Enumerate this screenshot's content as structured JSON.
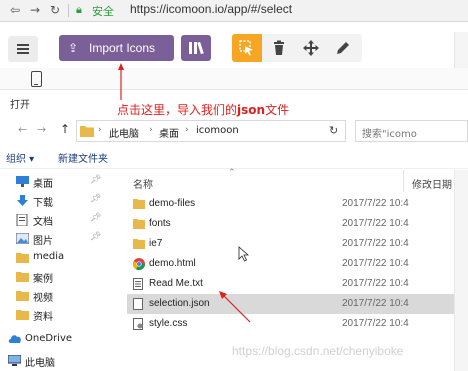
{
  "browser": {
    "secure_label": "安全",
    "url": "https://icomoon.io/app/#/select"
  },
  "toolbar": {
    "import_label": "Import Icons"
  },
  "dialog": {
    "title": "打开",
    "annotation_prefix": "点击这里，导入我们的",
    "annotation_bold": "json",
    "annotation_suffix": "文件",
    "breadcrumb": [
      "此电脑",
      "桌面",
      "icomoon"
    ],
    "search_placeholder": "搜索\"icomo",
    "organize_label": "组织 ▾",
    "new_folder_label": "新建文件夹",
    "columns": {
      "name": "名称",
      "modified": "修改日期"
    },
    "nav": [
      {
        "label": "桌面",
        "icon": "desktop-icon",
        "pinned": true
      },
      {
        "label": "下载",
        "icon": "download-icon",
        "pinned": true
      },
      {
        "label": "文档",
        "icon": "documents-icon",
        "pinned": true
      },
      {
        "label": "图片",
        "icon": "pictures-icon",
        "pinned": true
      },
      {
        "label": "media",
        "icon": "folder-icon",
        "pinned": false
      },
      {
        "label": "案例",
        "icon": "folder-icon",
        "pinned": false
      },
      {
        "label": "视频",
        "icon": "folder-icon",
        "pinned": false
      },
      {
        "label": "资料",
        "icon": "folder-icon",
        "pinned": false
      },
      {
        "label": "OneDrive",
        "icon": "onedrive-icon",
        "pinned": false
      },
      {
        "label": "此电脑",
        "icon": "computer-icon",
        "pinned": false
      }
    ],
    "files": [
      {
        "name": "demo-files",
        "date": "2017/7/22 10:4",
        "type": "folder"
      },
      {
        "name": "fonts",
        "date": "2017/7/22 10:4",
        "type": "folder"
      },
      {
        "name": "ie7",
        "date": "2017/7/22 10:4",
        "type": "folder"
      },
      {
        "name": "demo.html",
        "date": "2017/7/22 10:4",
        "type": "html"
      },
      {
        "name": "Read Me.txt",
        "date": "2017/7/22 10:4",
        "type": "text"
      },
      {
        "name": "selection.json",
        "date": "2017/7/22 10:4",
        "type": "json",
        "selected": true
      },
      {
        "name": "style.css",
        "date": "2017/7/22 10:4",
        "type": "css"
      }
    ]
  },
  "watermark": "https://blog.csdn.net/chenyiboke",
  "colors": {
    "import_button": "#7a5f99",
    "active_tool": "#f6a623",
    "annotation": "#e02020",
    "folder": "#e8b84a"
  }
}
